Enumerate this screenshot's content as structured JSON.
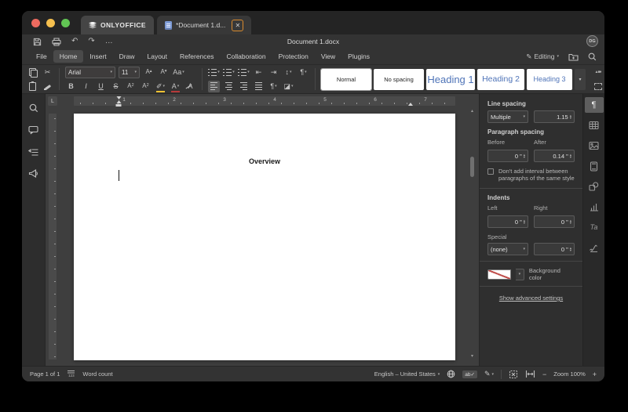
{
  "chrome": {
    "app_tab": "ONLYOFFICE",
    "doc_tab": "*Document 1.d...",
    "title": "Document 1.docx",
    "avatar": "DG"
  },
  "menu": {
    "items": [
      "File",
      "Home",
      "Insert",
      "Draw",
      "Layout",
      "References",
      "Collaboration",
      "Protection",
      "View",
      "Plugins"
    ],
    "active": "Home",
    "mode": "Editing"
  },
  "toolbar": {
    "font_name": "Arial",
    "font_size": "11",
    "styles": [
      "Normal",
      "No spacing",
      "Heading 1",
      "Heading 2",
      "Heading 3"
    ]
  },
  "icons": {
    "close": "✕",
    "undo": "↶",
    "redo": "↷",
    "more": "…",
    "cut": "✂",
    "bold": "B",
    "italic": "I",
    "underline": "U",
    "strike": "S",
    "superscript": "A",
    "sup_mark": "2",
    "subscript": "A",
    "sub_mark": "2",
    "inc_font": "A",
    "inc_mark": "▴",
    "dec_font": "A",
    "dec_mark": "▾",
    "change_case": "Aa",
    "highlight": "✐",
    "font_color": "A",
    "clear_style": "A",
    "dec_indent": "⇤",
    "inc_indent": "⇥",
    "line_spacing": "↕",
    "para_spacing": "¶",
    "nonprinting": "¶",
    "shading": "◪",
    "pilcrow": "¶",
    "chevron": "▾",
    "spin_up": "▴",
    "spin_down": "▾",
    "scroll_up": "▴",
    "scroll_down": "▾",
    "editing_pencil": "✎",
    "track_changes": "✎",
    "shapes_trio": "▲■●",
    "tab_selector": "L",
    "text_art": "Ta",
    "spell_ab": "ab",
    "spell_check": "✓",
    "count_num": "123",
    "minus": "−",
    "plus": "+"
  },
  "ruler": {
    "numbers": [
      "1",
      "2",
      "3",
      "4",
      "5",
      "6",
      "7"
    ]
  },
  "document": {
    "heading": "Overview"
  },
  "panel": {
    "line_spacing_label": "Line spacing",
    "line_spacing_select": "Multiple",
    "line_spacing_value": "1.15",
    "paragraph_spacing_label": "Paragraph spacing",
    "before_label": "Before",
    "after_label": "After",
    "before_value": "0 \"",
    "after_value": "0.14 \"",
    "interval_text": "Don't add interval between paragraphs of the same style",
    "indents_label": "Indents",
    "left_label": "Left",
    "right_label": "Right",
    "left_value": "0 \"",
    "right_value": "0 \"",
    "special_label": "Special",
    "special_select": "(none)",
    "special_value": "0 \"",
    "background_label": "Background color",
    "advanced_link": "Show advanced settings"
  },
  "statusbar": {
    "page": "Page 1 of 1",
    "word_count": "Word count",
    "language": "English – United States",
    "zoom": "Zoom 100%"
  },
  "colors": {
    "heading_blue": "#4f74b8",
    "focus_ring": "#d98a2e",
    "highlight_yellow": "#f1c232",
    "font_color_red": "#b63a3a"
  }
}
